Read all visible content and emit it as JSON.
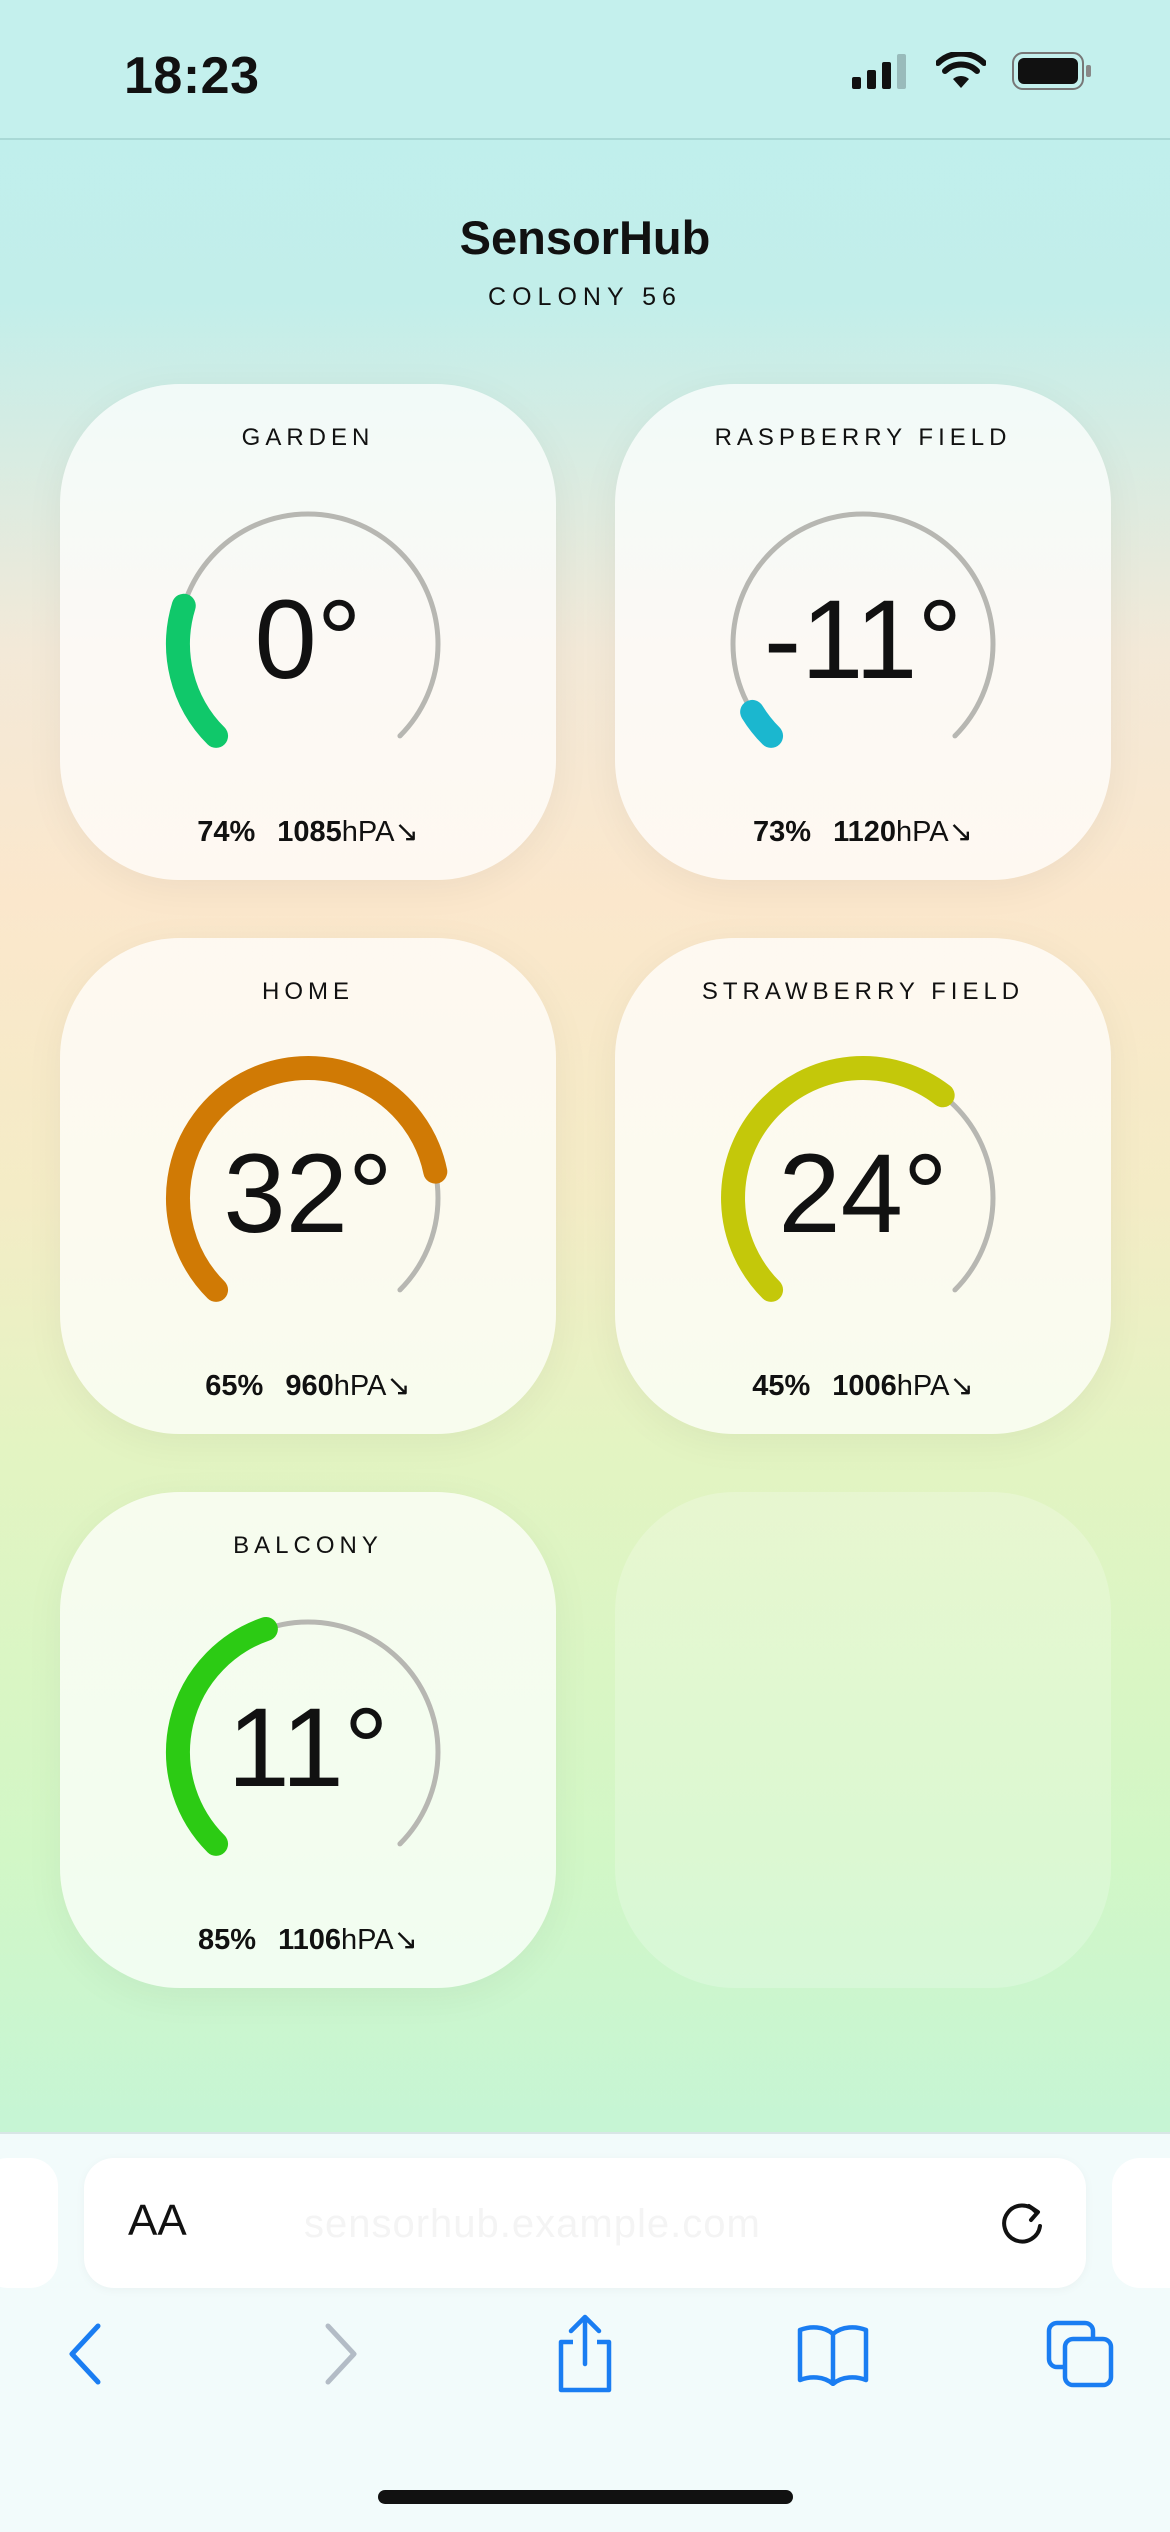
{
  "status_bar": {
    "time": "18:23",
    "icons": [
      "cellular-signal-icon",
      "wifi-icon",
      "battery-icon"
    ]
  },
  "header": {
    "title": "SensorHub",
    "subtitle": "COLONY 56"
  },
  "sensors": [
    {
      "label": "GARDEN",
      "temperature": "0°",
      "humidity": "74%",
      "pressure": "1085",
      "pressure_unit": "hPA",
      "trend": "↘",
      "gauge_fraction": 0.23,
      "color": "#10c86a"
    },
    {
      "label": "RASPBERRY FIELD",
      "temperature": "-11°",
      "humidity": "73%",
      "pressure": "1120",
      "pressure_unit": "hPA",
      "trend": "↘",
      "gauge_fraction": 0.05,
      "color": "#1bb7cf"
    },
    {
      "label": "HOME",
      "temperature": "32°",
      "humidity": "65%",
      "pressure": "960",
      "pressure_unit": "hPA",
      "trend": "↘",
      "gauge_fraction": 0.79,
      "color": "#d07a05"
    },
    {
      "label": "STRAWBERRY FIELD",
      "temperature": "24°",
      "humidity": "45%",
      "pressure": "1006",
      "pressure_unit": "hPA",
      "trend": "↘",
      "gauge_fraction": 0.64,
      "color": "#c4c80a"
    },
    {
      "label": "BALCONY",
      "temperature": "11°",
      "humidity": "85%",
      "pressure": "1106",
      "pressure_unit": "hPA",
      "trend": "↘",
      "gauge_fraction": 0.43,
      "color": "#2ccb14"
    }
  ],
  "browser": {
    "aa_label": "AA",
    "url": "sensorhub.example.com",
    "toolbar": [
      "back-icon",
      "forward-icon",
      "share-icon",
      "bookmarks-icon",
      "tabs-icon"
    ]
  },
  "colors": {
    "accent_blue": "#1a7df2",
    "gauge_track": "#b7b7b2"
  }
}
